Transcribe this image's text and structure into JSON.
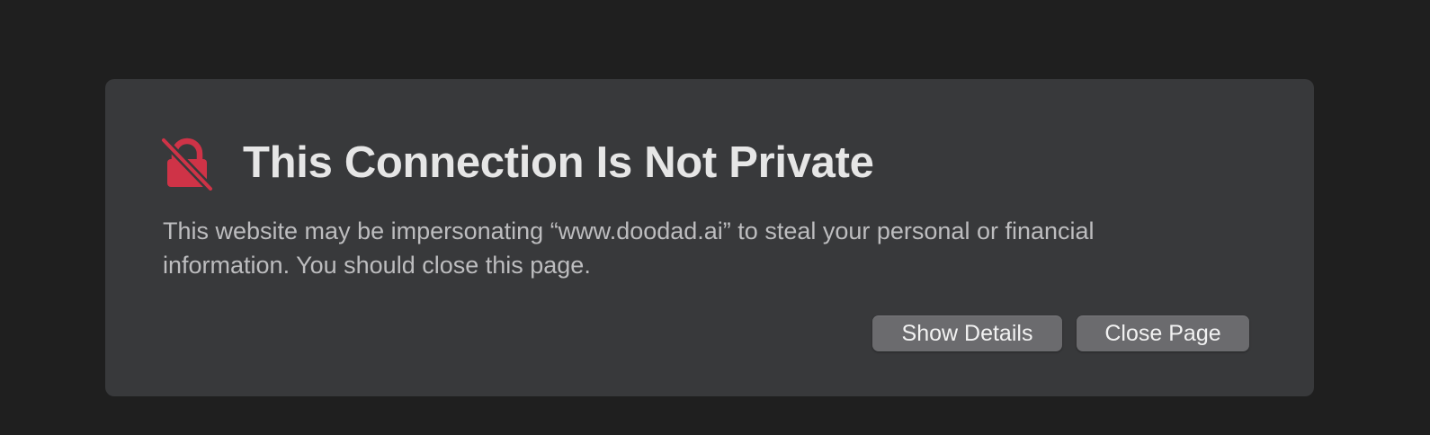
{
  "warning": {
    "icon": "lock-slash-icon",
    "icon_color": "#cf3347",
    "title": "This Connection Is Not Private",
    "message": "This website may be impersonating “www.doodad.ai” to steal your personal or financial information. You should close this page.",
    "buttons": {
      "show_details": "Show Details",
      "close_page": "Close Page"
    }
  },
  "colors": {
    "page_background": "#1f1f1f",
    "card_background": "#38393b",
    "button_background": "#6b6b6e",
    "title_text": "#e6e6e6",
    "body_text": "#bdbdbf"
  }
}
